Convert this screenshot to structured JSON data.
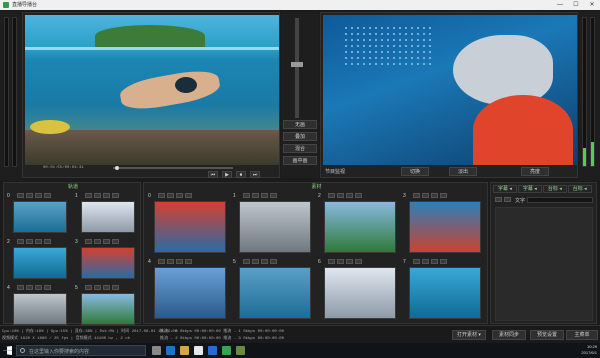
{
  "window": {
    "title": "直播导播台",
    "min": "—",
    "max": "☐",
    "close": "✕"
  },
  "preview": {
    "timecode": "00:01:55/00:04:31",
    "label": "",
    "controls": [
      "⏮",
      "▶",
      "⏹",
      "⏭"
    ]
  },
  "program": {
    "label": "节目监视",
    "btn_cut": "切换",
    "btn_fade": "淡出",
    "btn_bright": "亮度"
  },
  "overlay": {
    "items": [
      "无画",
      "叠加",
      "混合",
      "画中画"
    ]
  },
  "bin_left": {
    "title": "轨道",
    "cells": [
      {
        "n": "0"
      },
      {
        "n": "1"
      },
      {
        "n": "2"
      },
      {
        "n": "3"
      },
      {
        "n": "4"
      },
      {
        "n": "5"
      }
    ]
  },
  "bin_right": {
    "title": "素材",
    "cells": [
      {
        "n": "0"
      },
      {
        "n": "1"
      },
      {
        "n": "2"
      },
      {
        "n": "3"
      },
      {
        "n": "4"
      },
      {
        "n": "5"
      },
      {
        "n": "6"
      },
      {
        "n": "7"
      }
    ]
  },
  "right_panel": {
    "tabs": [
      "字幕 ◂",
      "字幕 ◂",
      "台标 ◂",
      "台标 ◂"
    ],
    "text_label": "文字"
  },
  "status": {
    "line1": "Cpu:10% | 内存:19% | Gpu:15% | 显存:38% | Dsk:0% | 时间 2017-06-01 10:29:00",
    "line2": "视频模式 1920 X 1080 / 25 fps | 音频模式 44100 hz , 2 ch",
    "line3": "推流 - 0 0kbps 00:00:00:00    推流 - 1 0kbps 00:00:00:00",
    "line4": "推流 - 2 0kbps 00:00:00:00    推流 - 3 0kbps 00:00:00:00"
  },
  "footer_buttons": [
    "打开素材 ▾",
    "素材同步",
    "预览设置",
    "主菜单"
  ],
  "taskbar": {
    "search": "在这里输入你要搜索的内容",
    "time": "10:29",
    "date": "2017/6/1"
  },
  "colors": {
    "accent": "#4fd04f",
    "brand": "#2a9d46"
  }
}
